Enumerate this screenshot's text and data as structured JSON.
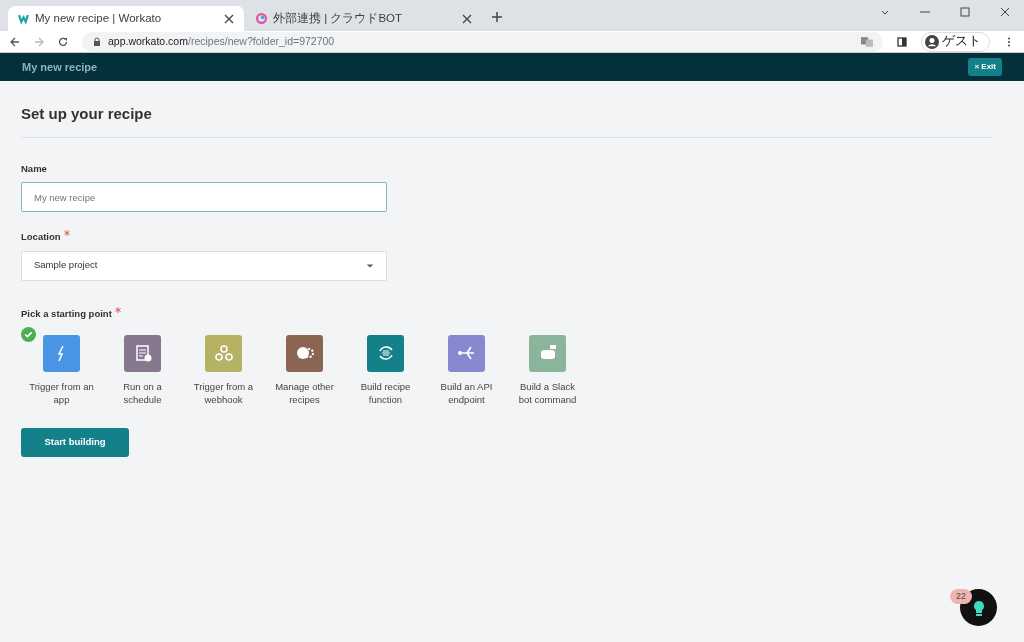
{
  "browser": {
    "tabs": [
      {
        "title": "My new recipe | Workato",
        "selected": true
      },
      {
        "title": "外部連携 | クラウドBOT",
        "selected": false
      }
    ],
    "url_host": "app.workato.com",
    "url_path": "/recipes/new?folder_id=972700",
    "profile": "ゲスト"
  },
  "header": {
    "title": "My new recipe",
    "exit": "Exit",
    "exit_icon": "×"
  },
  "page_title": "Set up your recipe",
  "name_field": {
    "label": "Name",
    "placeholder": "My new recipe"
  },
  "location_field": {
    "label": "Location",
    "required": true,
    "value": "Sample project"
  },
  "starting_point": {
    "label": "Pick a starting point",
    "required": true,
    "options": [
      {
        "kind": "app",
        "label": "Trigger from an app",
        "color": "#4a95e6",
        "selected": true
      },
      {
        "kind": "schedule",
        "label": "Run on a schedule",
        "color": "#87788f",
        "selected": false
      },
      {
        "kind": "webhook",
        "label": "Trigger from a webhook",
        "color": "#b5b263",
        "selected": false
      },
      {
        "kind": "manage",
        "label": "Manage other recipes",
        "color": "#8c6452",
        "selected": false
      },
      {
        "kind": "function",
        "label": "Build recipe function",
        "color": "#13808a",
        "selected": false
      },
      {
        "kind": "api",
        "label": "Build an API endpoint",
        "color": "#8689d0",
        "selected": false
      },
      {
        "kind": "slack",
        "label": "Build a Slack bot command",
        "color": "#8bb59a",
        "selected": false
      }
    ]
  },
  "start_button": "Start building",
  "help_badge": "22"
}
